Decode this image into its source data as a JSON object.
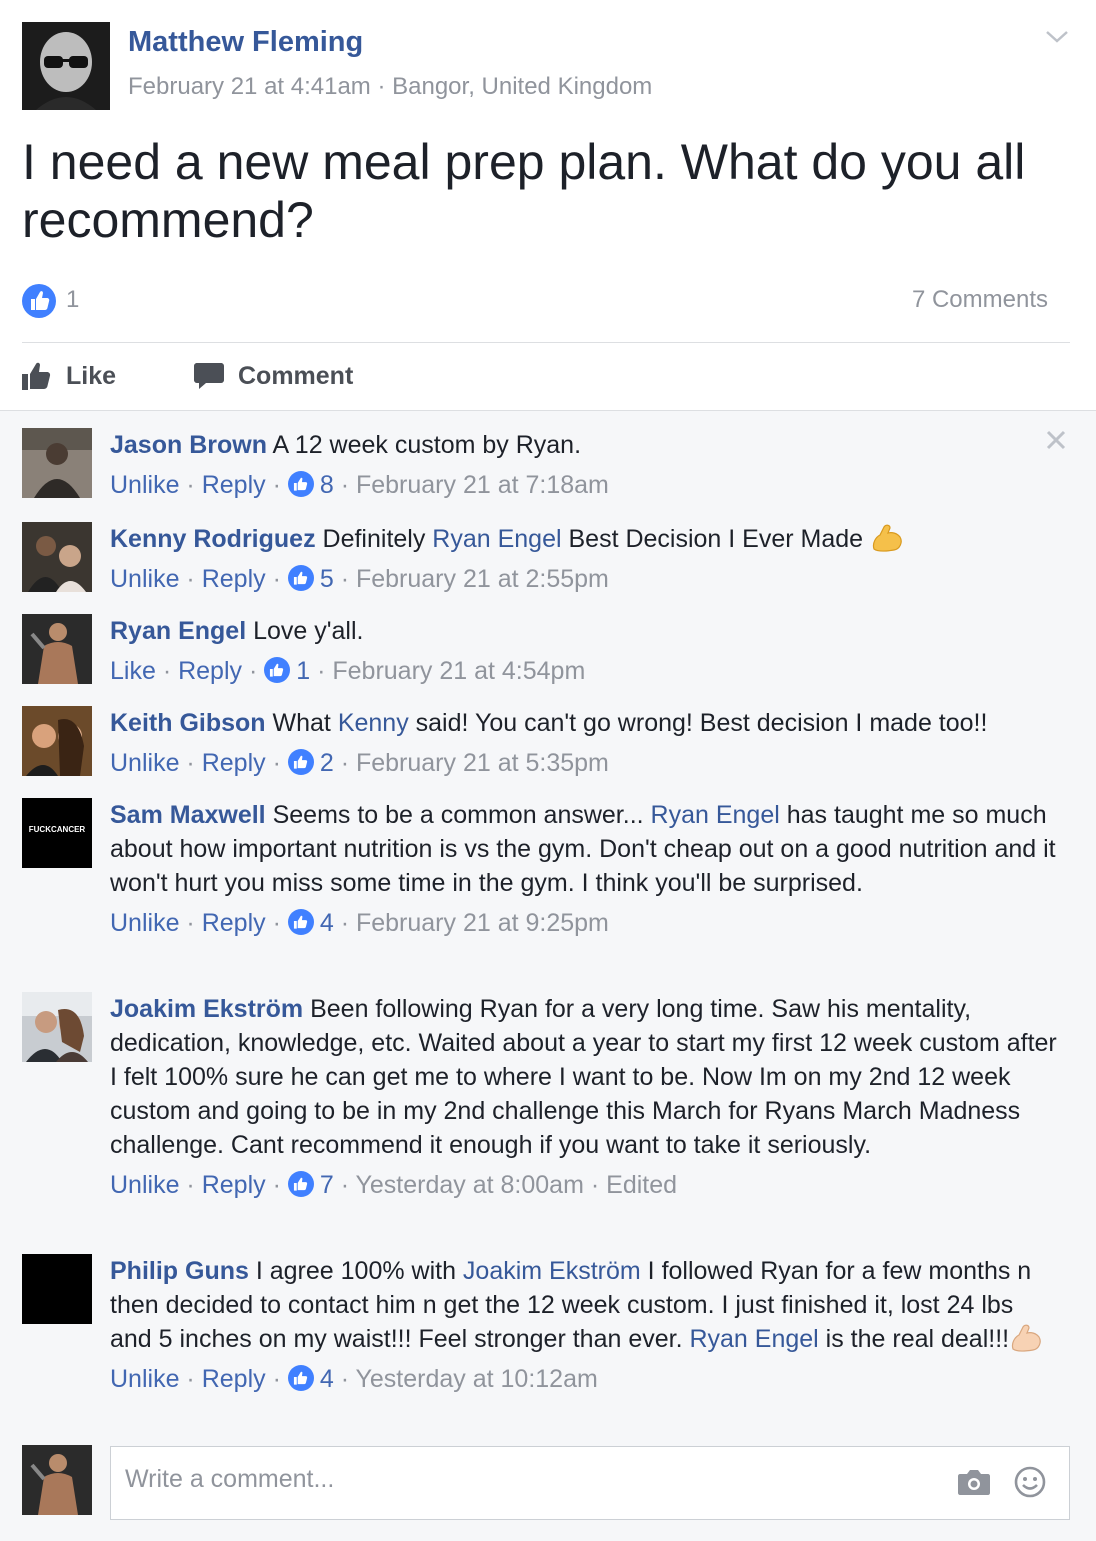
{
  "post": {
    "author": "Matthew Fleming",
    "meta": "February 21 at 4:41am · Bangor, United Kingdom",
    "text": "I need a new meal prep plan. What do you all recommend?",
    "like_count": "1",
    "comments_count": "7 Comments",
    "actions": {
      "like": "Like",
      "comment": "Comment"
    }
  },
  "comments": [
    {
      "name": "Jason Brown",
      "text": [
        " A 12 week custom by Ryan."
      ],
      "like_label": "Unlike",
      "reply_label": "Reply",
      "likes": "8",
      "time": "February 21 at 7:18am"
    },
    {
      "name": "Kenny Rodriguez",
      "text": [
        " Definitely ",
        "Ryan Engel",
        " Best Decision I Ever Made "
      ],
      "like_label": "Unlike",
      "reply_label": "Reply",
      "likes": "5",
      "time": "February 21 at 2:55pm"
    },
    {
      "name": "Ryan Engel",
      "text": [
        " Love y'all."
      ],
      "like_label": "Like",
      "reply_label": "Reply",
      "likes": "1",
      "time": "February 21 at 4:54pm"
    },
    {
      "name": "Keith Gibson",
      "text": [
        " What ",
        "Kenny",
        " said! You can't go wrong! Best decision I made too!!"
      ],
      "like_label": "Unlike",
      "reply_label": "Reply",
      "likes": "2",
      "time": "February 21 at 5:35pm"
    },
    {
      "name": "Sam Maxwell",
      "avatar_text": "FUCKCANCER",
      "text": [
        " Seems to be a common answer... ",
        "Ryan Engel",
        " has taught me so much about how important nutrition is vs the gym. Don't cheap out on a good nutrition and it won't hurt you miss some time in the gym. I think you'll be surprised."
      ],
      "like_label": "Unlike",
      "reply_label": "Reply",
      "likes": "4",
      "time": "February 21 at 9:25pm"
    },
    {
      "name": "Joakim Ekström",
      "text": [
        " Been following Ryan for a very long time. Saw his mentality, dedication, knowledge, etc. Waited about a year to start my first 12 week custom after I felt 100% sure he can get me to where I want to be. Now Im on my 2nd 12 week custom and going to be in my 2nd challenge this March for Ryans March Madness challenge. Cant recommend it enough if you want to take it seriously."
      ],
      "like_label": "Unlike",
      "reply_label": "Reply",
      "likes": "7",
      "time": "Yesterday at 8:00am",
      "edited": "Edited"
    },
    {
      "name": "Philip Guns",
      "text": [
        " I agree 100% with ",
        "Joakim Ekström",
        " I followed Ryan for a few months n then decided to contact him n get the 12 week custom. I just finished it, lost 24 lbs and 5 inches on my waist!!! Feel stronger than ever. ",
        "Ryan Engel",
        " is the real deal!!!"
      ],
      "like_label": "Unlike",
      "reply_label": "Reply",
      "likes": "4",
      "time": "Yesterday at 10:12am"
    }
  ],
  "composer": {
    "placeholder": "Write a comment..."
  },
  "separator": " · ",
  "colors": {
    "link": "#365899",
    "like_blue": "#4080ff",
    "muted": "#90949c",
    "comments_bg": "#f6f7f9"
  }
}
